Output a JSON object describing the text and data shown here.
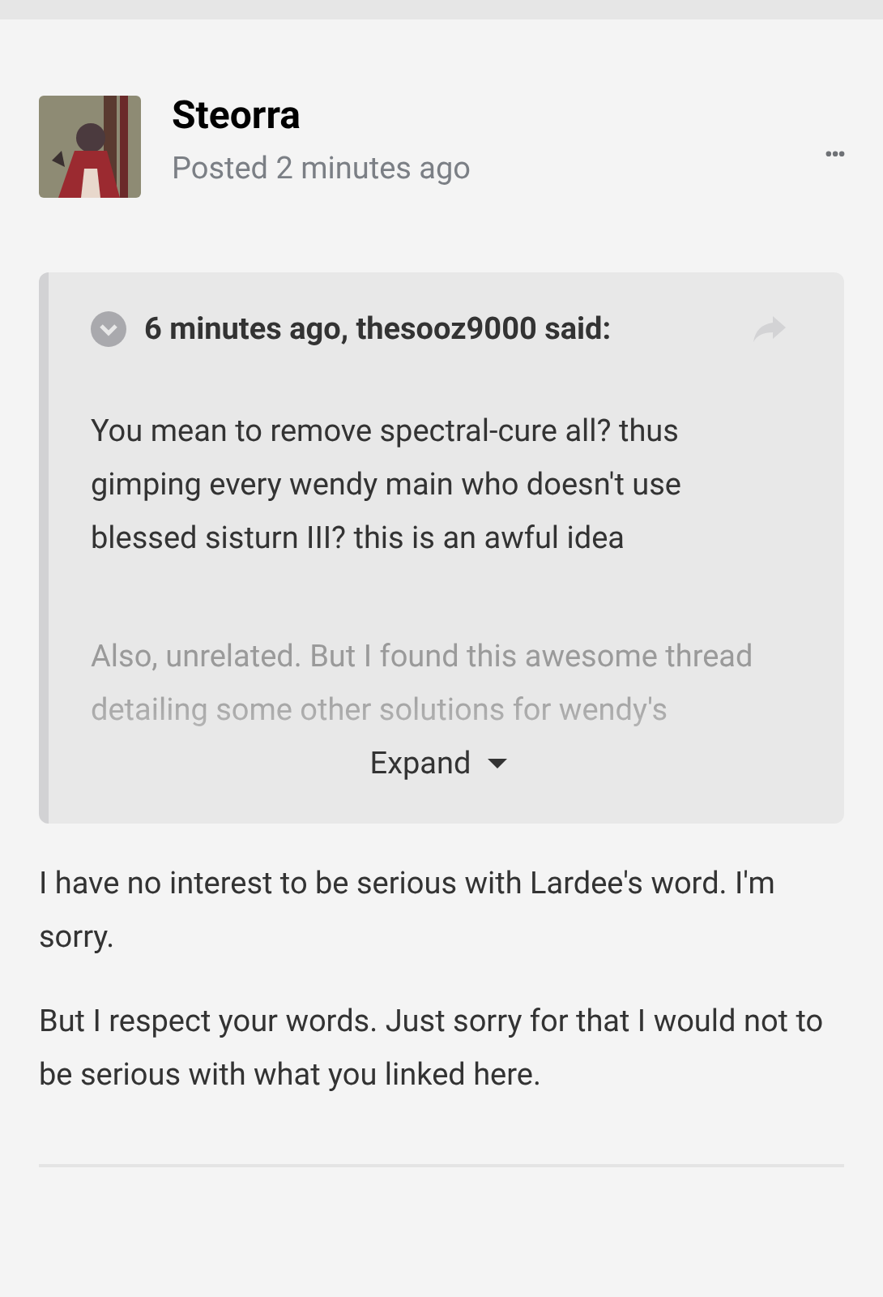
{
  "post": {
    "author": "Steorra",
    "posted": "Posted 2 minutes ago",
    "menu": "•••",
    "quote": {
      "header": "6 minutes ago, thesooz9000 said:",
      "paragraphs": [
        "You mean to remove spectral-cure all? thus gimping every wendy main who doesn't use blessed sisturn III? this is an awful idea",
        "Also, unrelated. But I found this awesome thread detailing some other solutions for wendy's"
      ],
      "expand": "Expand"
    },
    "body": [
      "I have no interest to be serious with Lardee's word. I'm sorry.",
      "But I respect your words. Just sorry for that I would not to be serious with what you linked here."
    ]
  }
}
